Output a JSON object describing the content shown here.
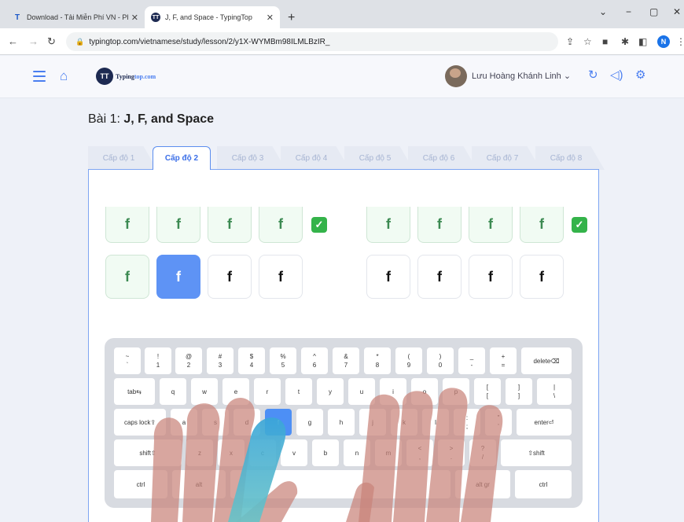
{
  "browser": {
    "tabs": [
      {
        "title": "Download - Tải Miễn Phí VN - Ph",
        "favicon": "T"
      },
      {
        "title": "J, F, and Space - TypingTop",
        "favicon": "TT"
      }
    ],
    "new_tab": "+",
    "window_controls": [
      "⌄",
      "−",
      "▢",
      "✕"
    ],
    "url": "typingtop.com/vietnamese/study/lesson/2/y1X-WYMBm98ILMLBzIR_",
    "profile_initial": "N"
  },
  "site": {
    "logo_mark": "TT",
    "logo_text": "Typing",
    "logo_suffix": "top.com",
    "username": "Lưu Hoàng Khánh Linh",
    "username_chevron": "⌄"
  },
  "lesson": {
    "prefix": "Bài 1: ",
    "title": "J, F, and Space",
    "levels": [
      "Cấp độ 1",
      "Cấp độ 2",
      "Cấp độ 3",
      "Cấp độ 4",
      "Cấp độ 5",
      "Cấp độ 6",
      "Cấp độ 7",
      "Cấp độ 8"
    ],
    "active_level": 1,
    "row1_left": [
      "f",
      "f",
      "f",
      "f"
    ],
    "row1_right": [
      "f",
      "f",
      "f",
      "f"
    ],
    "row2_left": [
      "f",
      "f",
      "f",
      "f"
    ],
    "row2_right": [
      "f",
      "f",
      "f",
      "f"
    ],
    "check": "✓"
  },
  "keyboard": {
    "row1": [
      [
        "~",
        "`"
      ],
      [
        "!",
        "1"
      ],
      [
        "@",
        "2"
      ],
      [
        "#",
        "3"
      ],
      [
        "$",
        "4"
      ],
      [
        "%",
        "5"
      ],
      [
        "^",
        "6"
      ],
      [
        "&",
        "7"
      ],
      [
        "*",
        "8"
      ],
      [
        "(",
        "9"
      ],
      [
        ")",
        "0"
      ],
      [
        "_",
        "-"
      ],
      [
        "+",
        "="
      ]
    ],
    "delete": "delete⌫",
    "tab": "tab⇆",
    "row2": [
      "q",
      "w",
      "e",
      "r",
      "t",
      "y",
      "u",
      "i",
      "o",
      "p"
    ],
    "row2_sym": [
      [
        "[",
        "["
      ],
      [
        "]",
        "]"
      ],
      [
        "|",
        "\\"
      ]
    ],
    "caps": "caps lock⇪",
    "row3": [
      "a",
      "s",
      "d",
      "f",
      "g",
      "h",
      "j",
      "k",
      "l"
    ],
    "row3_sym": [
      [
        ":",
        ";"
      ],
      [
        "\"",
        "'"
      ]
    ],
    "enter": "enter⏎",
    "shift_left": "shift⇧",
    "row4": [
      "z",
      "x",
      "c",
      "v",
      "b",
      "n",
      "m"
    ],
    "row4_sym": [
      [
        "<",
        ","
      ],
      [
        ">",
        "."
      ],
      [
        "?",
        "/"
      ]
    ],
    "shift_right": "⇧shift",
    "ctrl": "ctrl",
    "alt": "alt",
    "altgr": "alt gr",
    "ctrl_right": "ctrl",
    "highlight_key": "f"
  }
}
